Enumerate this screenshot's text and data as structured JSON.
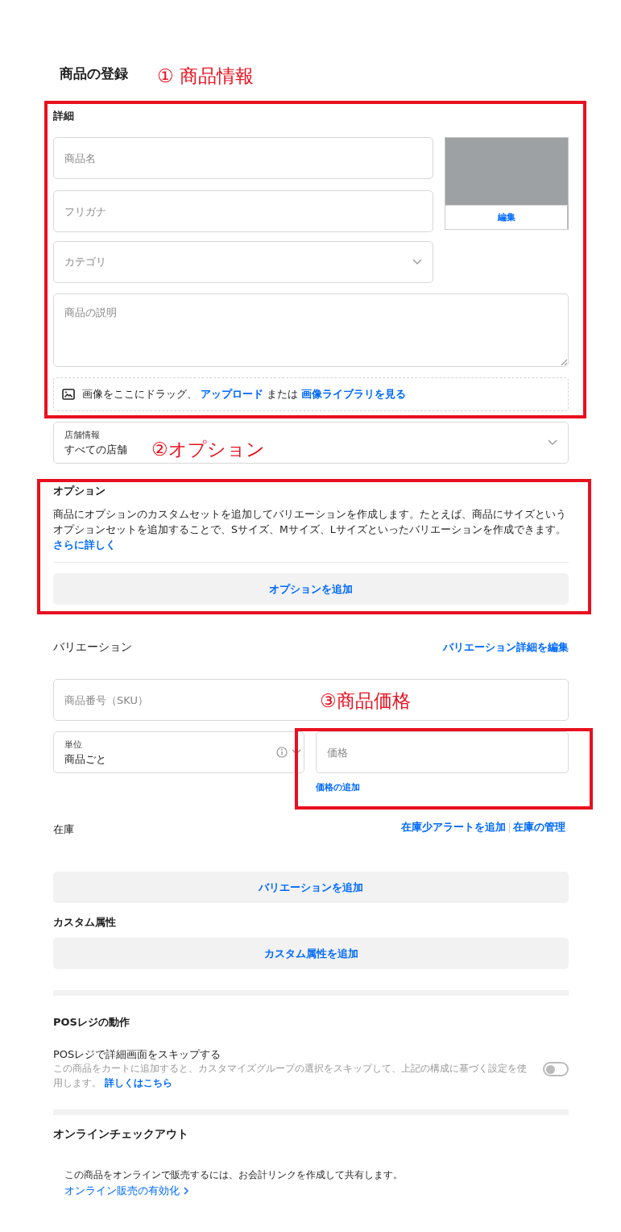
{
  "page_title": "商品の登録",
  "details": {
    "heading": "詳細",
    "name_field": {
      "placeholder": "商品名"
    },
    "furigana_field": {
      "placeholder": "フリガナ"
    },
    "category_select": {
      "placeholder": "カテゴリ"
    },
    "description_field": {
      "placeholder": "商品の説明"
    },
    "image": {
      "edit_button": "編集"
    },
    "upload_hint": {
      "text": "画像をここにドラッグ、",
      "upload_link": "アップロード",
      "or": "または",
      "library_link": "画像ライブラリを見る"
    }
  },
  "store_select": {
    "label": "店舗情報",
    "value": "すべての店舗"
  },
  "options": {
    "heading": "オプション",
    "description": "商品にオプションのカスタムセットを追加してバリエーションを作成します。たとえば、商品にサイズというオプションセットを追加することで、Sサイズ、Mサイズ、Lサイズといったバリエーションを作成できます。",
    "learn_more_link": "さらに詳しく",
    "add_button": "オプションを追加"
  },
  "variations": {
    "heading": "バリエーション",
    "edit_link": "バリエーション詳細を編集",
    "sku_field": {
      "placeholder": "商品番号（SKU）"
    },
    "unit_select": {
      "label": "単位",
      "value": "商品ごと"
    },
    "price_field": {
      "placeholder": "価格"
    },
    "add_price_link": "価格の追加",
    "stock_label": "在庫",
    "stock_links": [
      "在庫少アラートを追加",
      "在庫の管理"
    ],
    "add_button": "バリエーションを追加"
  },
  "custom_attributes": {
    "heading": "カスタム属性",
    "add_button": "カスタム属性を追加"
  },
  "pos": {
    "heading": "POSレジの動作",
    "setting_title": "POSレジで詳細画面をスキップする",
    "setting_description": "この商品をカートに追加すると、カスタマイズグループの選択をスキップして、上記の構成に基づく設定を使用します。",
    "details_link": "詳しくはこちら",
    "toggle": {
      "on": false
    }
  },
  "online_checkout": {
    "heading": "オンラインチェックアウト",
    "description": "この商品をオンラインで販売するには、お会計リンクを作成して共有します。",
    "enable_link": "オンライン販売の有効化"
  },
  "annotations": [
    {
      "label": "① 商品情報"
    },
    {
      "label": "②オプション"
    },
    {
      "label": "③商品価格"
    }
  ]
}
